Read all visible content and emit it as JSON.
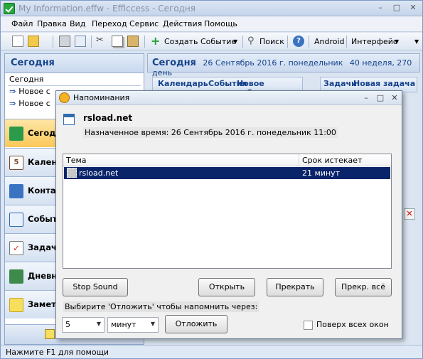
{
  "window": {
    "title": "My Information.effw - Efficcess - Сегодня",
    "minimize": "–",
    "maximize": "□",
    "close": "✕"
  },
  "menu": [
    "Файл",
    "Правка",
    "Вид",
    "Переход",
    "Сервис",
    "Действия",
    "Помощь"
  ],
  "toolbar": {
    "create_event": "Создать Событие",
    "search": "Поиск",
    "android": "Android",
    "interface": "Интерфейс"
  },
  "left": {
    "header": "Сегодня",
    "today_item": "Сегодня",
    "links": [
      "Новое с",
      "Новое с"
    ],
    "nav": [
      "Сегод",
      "Кален",
      "Конта",
      "Событ",
      "Задач",
      "Дневн",
      "Замет"
    ]
  },
  "right": {
    "header_title": "Сегодня",
    "header_date": "26 Сентябрь 2016 г. понедельник",
    "header_week": "40 неделя, 270 день",
    "tabs": [
      "Календарь",
      "События",
      "Новое событие"
    ],
    "tasks_tab": "Задачи",
    "new_task": "Новая задача"
  },
  "status": "Нажмите F1 для помощи",
  "dialog": {
    "title": "Напоминания",
    "subject": "rsload.net",
    "scheduled": "Назначенное время: 26 Сентябрь 2016 г. понедельник 11:00",
    "columns": [
      "Тема",
      "Срок истекает"
    ],
    "rows": [
      {
        "subject": "rsload.net",
        "expires": "21 минут"
      }
    ],
    "btn_stop_sound": "Stop Sound",
    "btn_open": "Открыть",
    "btn_stop": "Прекрать",
    "btn_stop_all": "Прекр. всё",
    "snooze_label": "Выбирите 'Отложить' чтобы напомнить через:",
    "snooze_value": "5",
    "snooze_unit": "минут",
    "btn_snooze": "Отложить",
    "on_top_label": "Поверх всех окон"
  }
}
